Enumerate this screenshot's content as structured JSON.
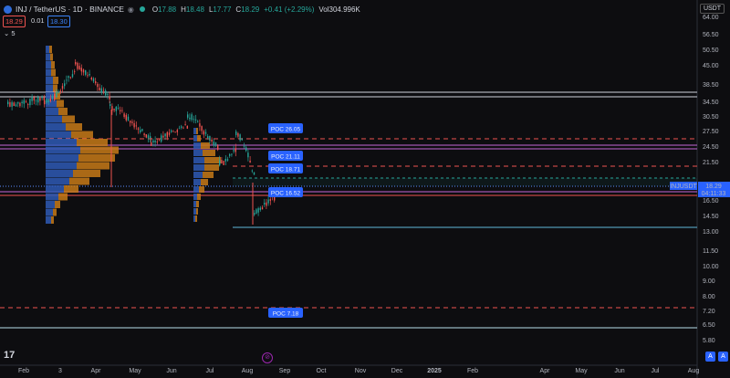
{
  "header": {
    "title": "INJ / TetherUS · 1D · BINANCE",
    "ohlc": [
      {
        "k": "O",
        "v": "17.88"
      },
      {
        "k": "H",
        "v": "18.48"
      },
      {
        "k": "L",
        "v": "17.77"
      },
      {
        "k": "C",
        "v": "18.29"
      },
      {
        "k": "",
        "v": "+0.41 (+2.29%)"
      },
      {
        "k": "Vol",
        "v": "304.996K"
      }
    ],
    "currency": "USDT"
  },
  "quote": {
    "bid": "18.29",
    "spread": "0.01",
    "ask": "18.30"
  },
  "collapse_label": "5",
  "price_axis": [
    "64.00",
    "56.50",
    "50.50",
    "45.00",
    "38.50",
    "34.50",
    "30.50",
    "27.50",
    "24.50",
    "21.50",
    "18.29",
    "16.50",
    "14.50",
    "13.00",
    "11.50",
    "10.00",
    "9.00",
    "8.00",
    "7.20",
    "6.50",
    "5.80"
  ],
  "time_axis": [
    "Feb",
    "3",
    "Apr",
    "May",
    "Jun",
    "Jul",
    "Aug",
    "Sep",
    "Oct",
    "Nov",
    "Dec",
    "2025",
    "Feb",
    "Apr",
    "May",
    "Jun",
    "Jul",
    "Aug"
  ],
  "symbol_tag": "INJUSDT",
  "last_price": "18.29",
  "countdown": "04:11:33",
  "poc_labels": [
    "POC 26.05",
    "POC 21.11",
    "POC 18.71",
    "POC 16.52",
    "POC 7.18"
  ],
  "buttons": {
    "auto": "A",
    "log": "A"
  },
  "colors": {
    "up": "#26a69a",
    "down": "#ef5350",
    "poc": "#2962ff",
    "vp_up": "#2f5bb5",
    "vp_down": "#c77a18"
  }
}
